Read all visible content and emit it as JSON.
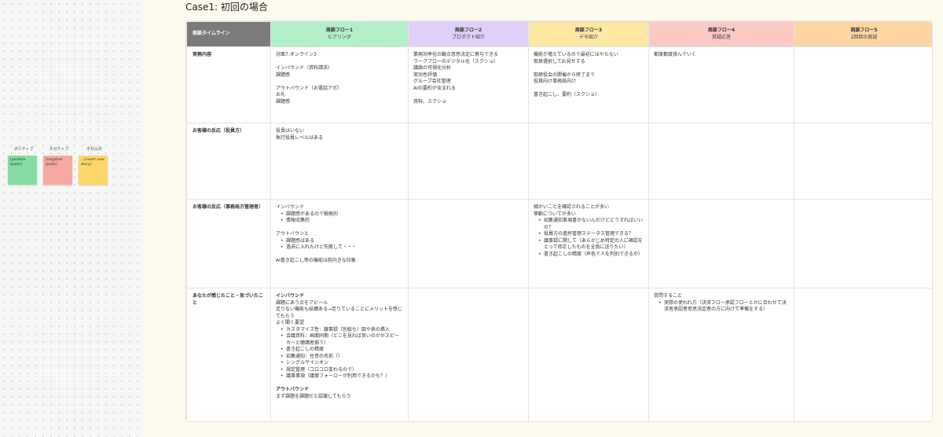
{
  "legend": {
    "positive": {
      "label": "ポジティブ",
      "text": "[positive quote]",
      "color": "#86dca2"
    },
    "negative": {
      "label": "ネガティブ",
      "text": "[negative quote]",
      "color": "#f6a9a1"
    },
    "other": {
      "label": "それ以外",
      "text": "...[insert user story]",
      "color": "#fcd86a"
    }
  },
  "page_title": "Case1: 初回の場合",
  "table": {
    "row_header": "商談タイムライン",
    "columns": [
      {
        "title": "商談フロー1",
        "subtitle": "ヒアリング",
        "color": "#b1f0c8"
      },
      {
        "title": "商談フロー2",
        "subtitle": "プロダクト紹介",
        "color": "#e0cff8"
      },
      {
        "title": "商談フロー3",
        "subtitle": "デモ紹介",
        "color": "#fde8a4"
      },
      {
        "title": "商談フロー4",
        "subtitle": "質疑応答",
        "color": "#fdc9c5"
      },
      {
        "title": "商談フロー5",
        "subtitle": "2回目の商談",
        "color": "#fdd6a3"
      }
    ],
    "rows": [
      {
        "label": "実務内容",
        "cells": [
          [
            "対面7:オンライン3",
            "",
            "インバウンド（資料請求）",
            "課題感",
            "",
            "アウトバウンド（お電話アポ）",
            "お礼",
            "課題感"
          ],
          [
            "業務効率化の観点意思決定に寄与できる",
            "ワークフローのデジタル化（スクショ）",
            "議論の可視化分析",
            "実効性評価",
            "グループ会社管理",
            "AIの要約が含まれる",
            "",
            "資料、スクショ"
          ],
          [
            "機能が増えているので最初にはやらない",
            "取捨選択してお見せする",
            "",
            "取締役会の開催から終了まで",
            "役員向け事務局向け",
            "",
            "書き起こし、要約（スクショ）"
          ],
          [
            "都度都度挟んでいく"
          ],
          []
        ]
      },
      {
        "label": "お客様の反応（役員方）",
        "cells": [
          [
            "役員はいない",
            "執行役員レベルはある"
          ],
          [],
          [],
          [],
          []
        ]
      },
      {
        "label": "お客様の反応（事務局方管理者）",
        "cells": [
          {
            "before": [
              "インバウンド"
            ],
            "bullets": [
              "課題感があるので積極的",
              "情報収集的"
            ],
            "mid": [
              "",
              "アウトバウンと"
            ],
            "bullets2": [
              "課題感はある",
              "過去に入れたけど失敗して・・・"
            ],
            "after": [
              "",
              "AI書き起こし等の機能は前向きな印象"
            ]
          },
          {},
          {
            "before": [
              "細かいことを確認されることが多い",
              "挙動についてが多い"
            ],
            "bullets": [
              "招集通知事項書かないんだけどどうすればいいの？",
              "役員方の進捗管理ステータス管理できる？",
              "議事録に関して（あらかじめ特定の人に確認をとって修正したものを全員に送りたい）",
              "書き起こしの精度（声色で人を判別できるか）"
            ]
          },
          {},
          {}
        ]
      },
      {
        "label": "あなたが感じたこと・気づいたこと",
        "cells": [
          {
            "heading": "インバウンド",
            "before": [
              "課題にあう点をアピール",
              "足りない機能も結構ある→足りていることにメリットを感じてもらう",
              "よく聞く要望"
            ],
            "bullets": [
              "カスタマイズ性：議事録（別紙も）図や表の挿入",
              "会議資料：画面同期（どこを見れば良いのかがスピーカーと聴講者揃う）",
              "書き起こしの精度",
              "招集通知：任意の名前（）",
              "シングルサインオン",
              "規定管理（コロコロ変わるので）",
              "議事事項（議案フォーローが利用できるかも？）"
            ],
            "heading2": "アウトバウンド",
            "after": [
              "まず課題を課題だと認識してもらう"
            ]
          },
          {},
          {},
          {
            "before": [
              "質問すること"
            ],
            "bullets": [
              "実際の使われ方（決済フロー承認フローとかに合わせて決済者承認者意思決定者の方に向けて準備をする）"
            ]
          },
          {}
        ]
      }
    ]
  }
}
